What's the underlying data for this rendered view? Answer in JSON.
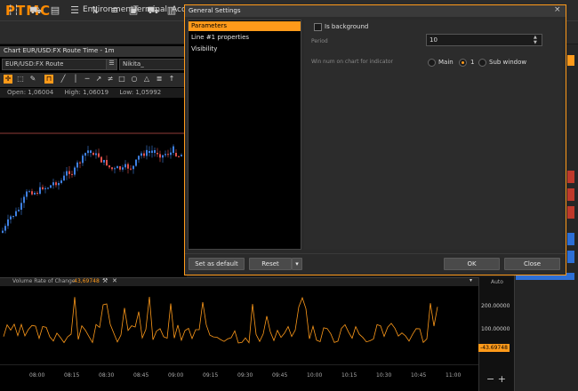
{
  "app": {
    "logo": "PTMC"
  },
  "menu": [
    "Environment",
    "Terminal",
    "Acc"
  ],
  "chart": {
    "title": "Chart EUR/USD:FX Route Time - 1m",
    "symbol": "EUR/USD:FX Route",
    "user": "Nikita_",
    "ohlc": {
      "open": "Open:  1,06004",
      "high": "High:  1,06019",
      "low": "Low:  1,05992"
    }
  },
  "indicator": {
    "name": "Volume Rate of Change",
    "value": "-43,69748",
    "auto": "Auto",
    "price_labels": [
      "200.00000",
      "100.00000"
    ],
    "current_value": "-43.69748",
    "time_labels": [
      "08:00",
      "08:15",
      "08:30",
      "08:45",
      "09:00",
      "09:15",
      "09:30",
      "09:45",
      "10:00",
      "10:15",
      "10:30",
      "10:45",
      "11:00"
    ]
  },
  "dialog": {
    "title": "General Settings",
    "close": "×",
    "list": [
      "Parameters",
      "Line #1 properties",
      "Visibility"
    ],
    "selected_index": 0,
    "is_background_label": "Is background",
    "period_label": "Period",
    "period_value": "10",
    "win_num_label": "Win num on chart for indicator",
    "radio_main": "Main",
    "radio_1": "1",
    "radio_sub": "Sub window",
    "radio_selected": "1",
    "btn_default": "Set as default",
    "btn_reset": "Reset",
    "btn_ok": "OK",
    "btn_close": "Close"
  },
  "colors": {
    "accent": "#ff9a1a",
    "bull": "#3d7fe0",
    "bear": "#e0504a"
  }
}
